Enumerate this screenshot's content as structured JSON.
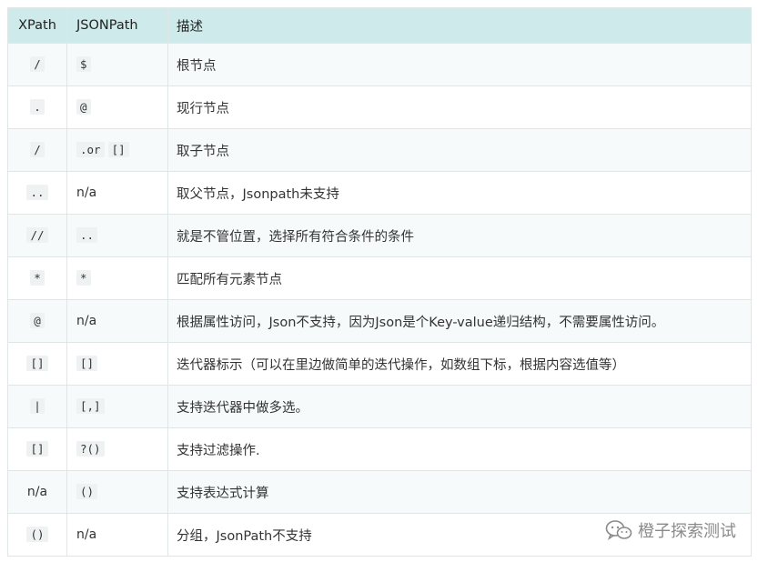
{
  "table": {
    "headers": [
      "XPath",
      "JSONPath",
      "描述"
    ],
    "rows": [
      {
        "xpath": "/",
        "xpath_code": true,
        "jsonpath": "$",
        "jsonpath_code": true,
        "desc": "根节点"
      },
      {
        "xpath": ".",
        "xpath_code": true,
        "jsonpath": "@",
        "jsonpath_code": true,
        "desc": "现行节点"
      },
      {
        "xpath": "/",
        "xpath_code": true,
        "jsonpath_parts": [
          ".or",
          "[]"
        ],
        "desc": "取子节点"
      },
      {
        "xpath": "..",
        "xpath_code": true,
        "jsonpath": "n/a",
        "jsonpath_code": false,
        "desc": "取父节点，Jsonpath未支持"
      },
      {
        "xpath": "//",
        "xpath_code": true,
        "jsonpath": "..",
        "jsonpath_code": true,
        "desc": "就是不管位置，选择所有符合条件的条件"
      },
      {
        "xpath": "*",
        "xpath_code": true,
        "jsonpath": "*",
        "jsonpath_code": true,
        "desc": "匹配所有元素节点"
      },
      {
        "xpath": "@",
        "xpath_code": true,
        "jsonpath": "n/a",
        "jsonpath_code": false,
        "desc": "根据属性访问，Json不支持，因为Json是个Key-value递归结构，不需要属性访问。"
      },
      {
        "xpath": "[]",
        "xpath_code": true,
        "jsonpath": "[]",
        "jsonpath_code": true,
        "desc": "迭代器标示（可以在里边做简单的迭代操作，如数组下标，根据内容选值等）"
      },
      {
        "xpath": "|",
        "xpath_code": true,
        "jsonpath": "[,]",
        "jsonpath_code": true,
        "desc": "支持迭代器中做多选。"
      },
      {
        "xpath": "[]",
        "xpath_code": true,
        "jsonpath": "?()",
        "jsonpath_code": true,
        "desc": "支持过滤操作."
      },
      {
        "xpath": "n/a",
        "xpath_code": false,
        "jsonpath": "()",
        "jsonpath_code": true,
        "desc": "支持表达式计算"
      },
      {
        "xpath": "()",
        "xpath_code": true,
        "jsonpath": "n/a",
        "jsonpath_code": false,
        "desc": "分组，JsonPath不支持"
      }
    ]
  },
  "watermark": {
    "text": "橙子探索测试",
    "icon": "wechat-icon"
  }
}
